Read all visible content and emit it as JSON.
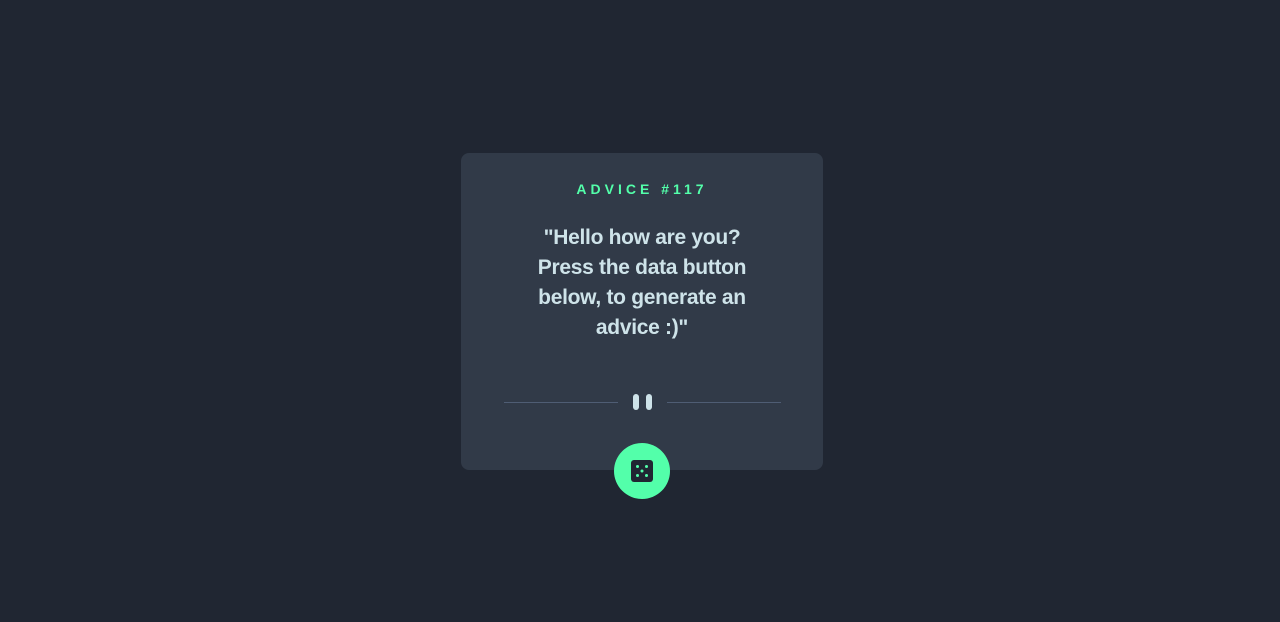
{
  "card": {
    "advice_label": "ADVICE #117",
    "quote": "\"Hello how are you? Press the data button below, to generate an advice :)\""
  },
  "divider": {
    "icon": "pause-icon"
  },
  "button": {
    "icon": "dice-icon"
  },
  "colors": {
    "background": "#202632",
    "card": "#313a48",
    "accent": "#53ffaa",
    "text": "#cee3e9",
    "divider": "#4f5d74"
  }
}
